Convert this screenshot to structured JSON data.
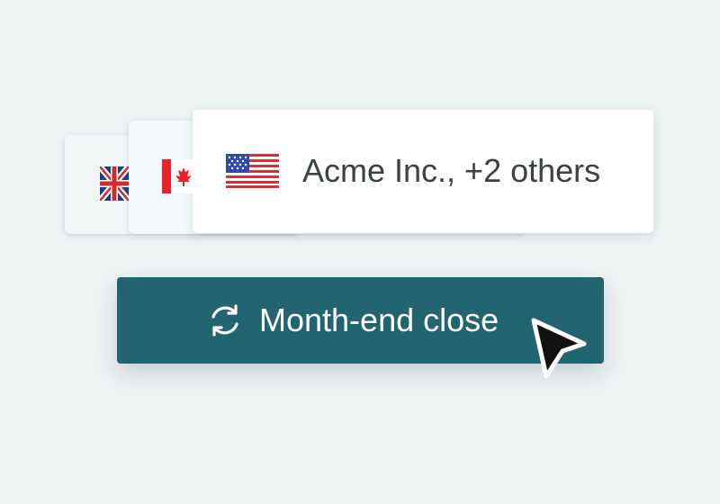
{
  "entity_selector": {
    "label": "Acme Inc., +2 others",
    "flags": [
      "uk-flag-icon",
      "canada-flag-icon",
      "us-flag-icon"
    ]
  },
  "action_button": {
    "label": "Month-end close",
    "icon": "refresh-icon"
  },
  "pointer": "cursor-arrow-icon",
  "colors": {
    "background": "#eef3f4",
    "button": "#226470",
    "text": "#3a4246"
  }
}
